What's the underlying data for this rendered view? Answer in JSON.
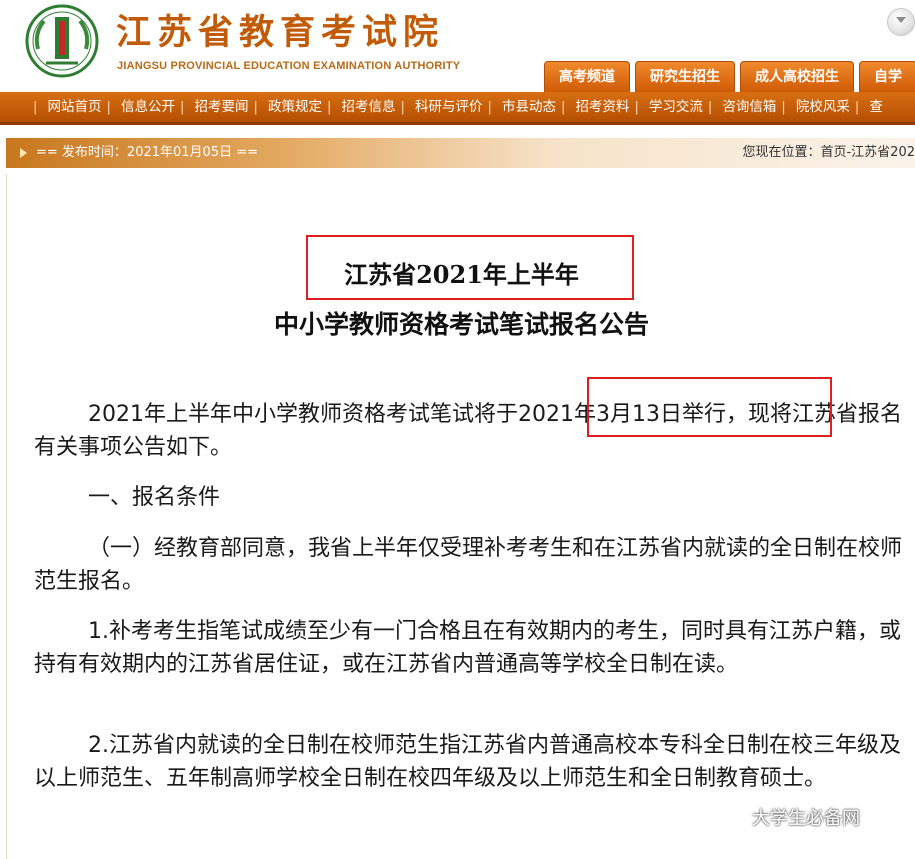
{
  "header": {
    "site_name_cn": "江苏省教育考试院",
    "site_name_en": "JIANGSU PROVINCIAL EDUCATION EXAMINATION AUTHORITY",
    "channel_tabs": [
      "高考频道",
      "研究生招生",
      "成人高校招生",
      "自学"
    ],
    "accent_color": "#d9680d"
  },
  "nav": {
    "items": [
      "网站首页",
      "信息公开",
      "招考要闻",
      "政策规定",
      "招考信息",
      "科研与评价",
      "市县动态",
      "招考资料",
      "学习交流",
      "咨询信箱",
      "院校风采",
      "查"
    ]
  },
  "infobar": {
    "publish_time": "== 发布时间：2021年01月05日 ==",
    "location": "您现在位置：首页-江苏省202"
  },
  "article": {
    "title_line1": "江苏省2021年上半年",
    "title_line2": "中小学教师资格考试笔试报名公告",
    "paragraphs": {
      "p1_before": "2021年上半年中小学教师资格考试笔试将于",
      "p1_highlight": "2021年3月13日举行",
      "p1_after": "，现将江苏省报名有关事项公告如下。",
      "p2": "一、报名条件",
      "p3": "（一）经教育部同意，我省上半年仅受理补考考生和在江苏省内就读的全日制在校师范生报名。",
      "p4": "1.补考考生指笔试成绩至少有一门合格且在有效期内的考生，同时具有江苏户籍，或持有有效期内的江苏省居住证，或在江苏省内普通高等学校全日制在读。",
      "p5": "2.江苏省内就读的全日制在校师范生指江苏省内普通高校本专科全日制在校三年级及以上师范生、五年制高师学校全日制在校四年级及以上师范生和全日制教育硕士。"
    },
    "highlight_color": "#e01e1e"
  },
  "watermark": {
    "text": "大学生必备网",
    "icon": "wechat-icon"
  }
}
